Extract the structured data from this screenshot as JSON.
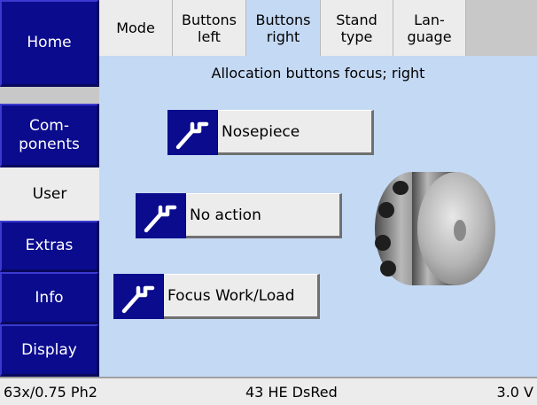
{
  "nav": {
    "home": "Home",
    "components": "Com-\nponents",
    "user": "User",
    "extras": "Extras",
    "info": "Info",
    "display": "Display"
  },
  "tabs": [
    {
      "label": "Mode"
    },
    {
      "label": "Buttons\nleft"
    },
    {
      "label": "Buttons\nright"
    },
    {
      "label": "Stand\ntype"
    },
    {
      "label": "Lan-\nguage"
    }
  ],
  "subtitle": "Allocation buttons focus; right",
  "actions": [
    {
      "label": "Nosepiece",
      "icon": "wrench-icon"
    },
    {
      "label": "No action",
      "icon": "wrench-icon"
    },
    {
      "label": "Focus Work/Load",
      "icon": "wrench-icon"
    }
  ],
  "status": {
    "objective": "63x/0.75 Ph2",
    "filter": "43 HE DsRed",
    "version": "3.0 V"
  },
  "colors": {
    "nav_blue": "#0b0b8e",
    "content_bg": "#c4d9f4",
    "button_gray": "#ececec"
  }
}
